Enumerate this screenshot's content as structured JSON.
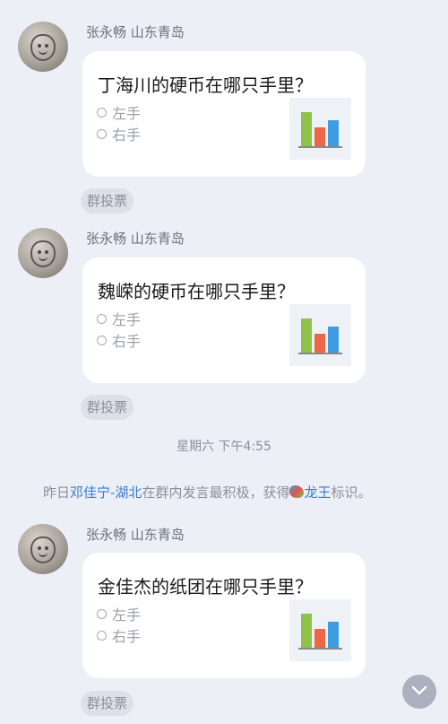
{
  "messages": [
    {
      "sender": "张永畅 山东青岛",
      "question": "丁海川的硬币在哪只手里？",
      "options": [
        "左手",
        "右手"
      ],
      "tag": "群投票"
    },
    {
      "sender": "张永畅 山东青岛",
      "question": "魏嵘的硬币在哪只手里？",
      "options": [
        "左手",
        "右手"
      ],
      "tag": "群投票"
    },
    {
      "sender": "张永畅 山东青岛",
      "question": "金佳杰的纸团在哪只手里？",
      "options": [
        "左手",
        "右手"
      ],
      "tag": "群投票"
    }
  ],
  "timestamp": "星期六 下午4:55",
  "system_notice": {
    "prefix": "昨日",
    "user_link": "邓佳宁-湖北",
    "middle": "在群内发言最积极，获得",
    "title_link": "龙王",
    "suffix": "标识。"
  },
  "colors": {
    "background": "#eceff6",
    "bubble": "#ffffff",
    "link": "#3b7ad0",
    "bar_green": "#8fc24a",
    "bar_red": "#ee6645",
    "bar_blue": "#3d9de0"
  },
  "icons": {
    "poll": "bar-chart-icon",
    "dragon": "dragon-king-icon",
    "scroll": "chevron-down-icon"
  }
}
